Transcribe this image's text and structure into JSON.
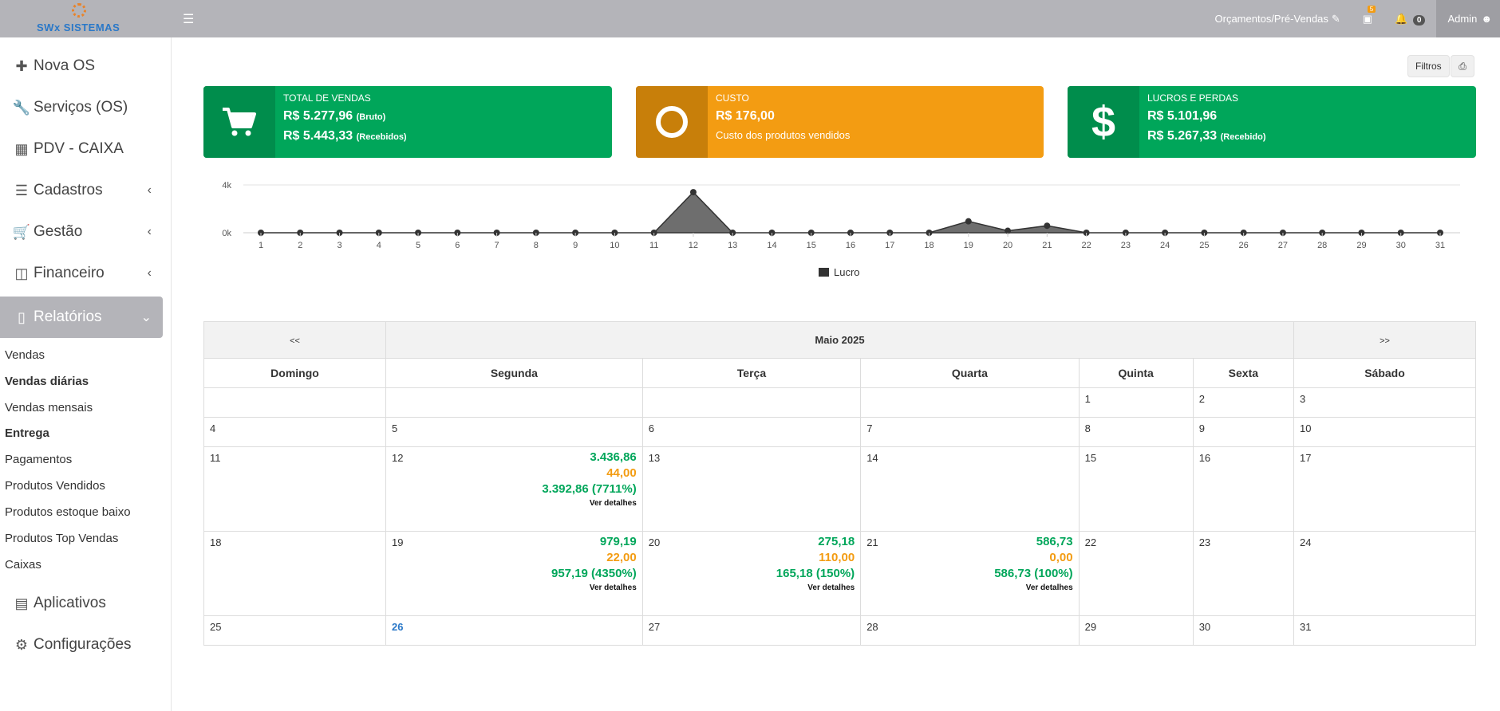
{
  "app": {
    "brand": "SWx SISTEMAS"
  },
  "topbar": {
    "quotes_label": "Orçamentos/Pré-Vendas",
    "cart_badge": "5",
    "notif_count": "0",
    "user_label": "Admin"
  },
  "sidebar": {
    "items": [
      {
        "label": "Nova OS",
        "icon": "plus-icon"
      },
      {
        "label": "Serviços (OS)",
        "icon": "wrench-icon"
      },
      {
        "label": "PDV - CAIXA",
        "icon": "grid-icon"
      },
      {
        "label": "Cadastros",
        "icon": "list-icon"
      },
      {
        "label": "Gestão",
        "icon": "cart-icon"
      },
      {
        "label": "Financeiro",
        "icon": "money-icon"
      },
      {
        "label": "Relatórios",
        "icon": "bar-chart-icon"
      },
      {
        "label": "Aplicativos",
        "icon": "server-icon"
      },
      {
        "label": "Configurações",
        "icon": "gears-icon"
      }
    ],
    "subitems": [
      {
        "label": "Vendas"
      },
      {
        "label": "Vendas diárias"
      },
      {
        "label": "Vendas mensais"
      },
      {
        "label": "Entrega"
      },
      {
        "label": "Pagamentos"
      },
      {
        "label": "Produtos Vendidos"
      },
      {
        "label": "Produtos estoque baixo"
      },
      {
        "label": "Produtos Top Vendas"
      },
      {
        "label": "Caixas"
      }
    ]
  },
  "toolbar": {
    "filter_label": "Filtros"
  },
  "cards": {
    "vendas": {
      "title": "TOTAL DE VENDAS",
      "value1": "R$ 5.277,96",
      "suffix1": "(Bruto)",
      "value2": "R$ 5.443,33",
      "suffix2": "(Recebidos)",
      "color": "#00a65a"
    },
    "custo": {
      "title": "CUSTO",
      "value1": "R$ 176,00",
      "note": "Custo dos produtos vendidos",
      "color": "#f39c12"
    },
    "lucros": {
      "title": "LUCROS E PERDAS",
      "value1": "R$ 5.101,96",
      "value2": "R$ 5.267,33",
      "suffix2": "(Recebido)",
      "color": "#00a65a"
    }
  },
  "chart_data": {
    "type": "area",
    "x": [
      1,
      2,
      3,
      4,
      5,
      6,
      7,
      8,
      9,
      10,
      11,
      12,
      13,
      14,
      15,
      16,
      17,
      18,
      19,
      20,
      21,
      22,
      23,
      24,
      25,
      26,
      27,
      28,
      29,
      30,
      31
    ],
    "series": [
      {
        "name": "Lucro",
        "values": [
          0,
          0,
          0,
          0,
          0,
          0,
          0,
          0,
          0,
          0,
          0,
          3393,
          0,
          0,
          0,
          0,
          0,
          0,
          957,
          165,
          587,
          0,
          0,
          0,
          0,
          0,
          0,
          0,
          0,
          0,
          0
        ]
      }
    ],
    "ylim": [
      0,
      4000
    ],
    "yticks": [
      "0k",
      "4k"
    ],
    "grid": true,
    "legend": "bottom",
    "color": "#555555"
  },
  "calendar": {
    "prev_label": "<<",
    "next_label": ">>",
    "month_label": "Maio 2025",
    "weekdays": [
      "Domingo",
      "Segunda",
      "Terça",
      "Quarta",
      "Quinta",
      "Sexta",
      "Sábado"
    ],
    "details_label": "Ver detalhes",
    "today": "26",
    "weeks": [
      [
        "",
        "",
        "",
        "",
        "1",
        "2",
        "3"
      ],
      [
        "4",
        "5",
        "6",
        "7",
        "8",
        "9",
        "10"
      ],
      [
        "11",
        "12",
        "13",
        "14",
        "15",
        "16",
        "17"
      ],
      [
        "18",
        "19",
        "20",
        "21",
        "22",
        "23",
        "24"
      ],
      [
        "25",
        "26",
        "27",
        "28",
        "29",
        "30",
        "31"
      ]
    ],
    "entries": {
      "12": {
        "vendas": "3.436,86",
        "custo": "44,00",
        "lucro": "3.392,86 (7711%)"
      },
      "19": {
        "vendas": "979,19",
        "custo": "22,00",
        "lucro": "957,19 (4350%)"
      },
      "20": {
        "vendas": "275,18",
        "custo": "110,00",
        "lucro": "165,18 (150%)"
      },
      "21": {
        "vendas": "586,73",
        "custo": "0,00",
        "lucro": "586,73 (100%)"
      }
    }
  }
}
